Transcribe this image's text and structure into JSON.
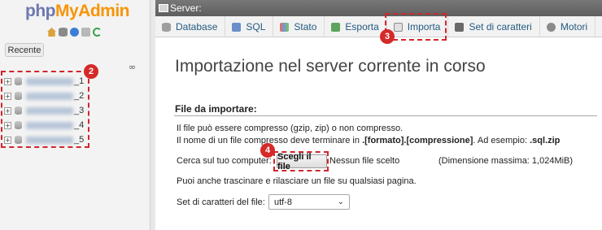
{
  "logo": {
    "part1": "php",
    "part2": "MyAdmin"
  },
  "nav": {
    "icons": [
      "home-icon",
      "database-icon",
      "help-icon",
      "docs-icon",
      "reload-icon"
    ],
    "recent_button": "Recente",
    "link_icon": "∞",
    "databases": [
      {
        "suffix": "_1"
      },
      {
        "suffix": "_2"
      },
      {
        "suffix": "_3"
      },
      {
        "suffix": "_4"
      },
      {
        "suffix": "_5"
      }
    ]
  },
  "topbar": {
    "server_label": "Server:"
  },
  "tabs": [
    {
      "label": "Database",
      "icon": "database-icon"
    },
    {
      "label": "SQL",
      "icon": "sql-icon"
    },
    {
      "label": "Stato",
      "icon": "status-icon"
    },
    {
      "label": "Esporta",
      "icon": "export-icon"
    },
    {
      "label": "Importa",
      "icon": "import-icon",
      "active": true
    },
    {
      "label": "Set di caratteri",
      "icon": "charset-icon"
    },
    {
      "label": "Motori",
      "icon": "engines-icon"
    }
  ],
  "main": {
    "heading": "Importazione nel server corrente in corso",
    "section_title": "File da importare:",
    "compress_note": "Il file può essere compresso (gzip, zip) o non compresso.",
    "name_note_prefix": "Il nome di un file compresso deve terminare in ",
    "name_note_format": ".[formato].[compressione]",
    "name_note_mid": ". Ad esempio: ",
    "name_note_example": ".sql.zip",
    "browse_label": "Cerca sul tuo computer:",
    "choose_button": "Scegli il file",
    "no_file": "Nessun file scelto",
    "max_size": "(Dimensione massima: 1,024MiB)",
    "drag_note": "Puoi anche trascinare e rilasciare un file su qualsiasi pagina.",
    "charset_label": "Set di caratteri del file:",
    "charset_value": "utf-8"
  },
  "annotations": {
    "badge_2": "2",
    "badge_3": "3",
    "badge_4": "4"
  },
  "colors": {
    "callout": "#d0262c",
    "logo_php": "#6c78af",
    "logo_myadmin": "#f89406",
    "link": "#235a81"
  }
}
